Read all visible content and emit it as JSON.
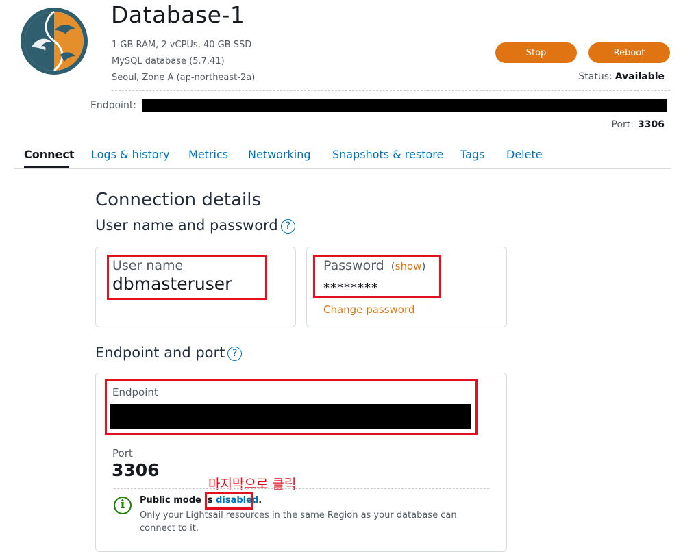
{
  "header": {
    "title": "Database-1",
    "specs": [
      "1 GB RAM, 2 vCPUs, 40 GB SSD",
      "MySQL database (5.7.41)",
      "Seoul, Zone A (ap-northeast-2a)"
    ],
    "stop_label": "Stop",
    "reboot_label": "Reboot",
    "status_label": "Status:",
    "status_value": "Available",
    "endpoint_label": "Endpoint:",
    "port_label": "Port:",
    "port_value": "3306",
    "logo_icon": "mysql-dolphin-icon"
  },
  "tabs": [
    {
      "label": "Connect",
      "active": true
    },
    {
      "label": "Logs & history"
    },
    {
      "label": "Metrics"
    },
    {
      "label": "Networking"
    },
    {
      "label": "Snapshots & restore"
    },
    {
      "label": "Tags"
    },
    {
      "label": "Delete"
    }
  ],
  "connection": {
    "heading": "Connection details",
    "userpass_heading": "User name and password",
    "help_glyph": "?",
    "user_label": "User name",
    "user_value": "dbmasteruser",
    "password_label": "Password",
    "show_open": "(",
    "show_label": "show",
    "show_close": ")",
    "password_value": "********",
    "change_password_label": "Change password"
  },
  "endpoint_section": {
    "heading": "Endpoint and port",
    "endpoint_label": "Endpoint",
    "port_label": "Port",
    "port_value": "3306",
    "annotation": "마지막으로 클릭",
    "public_mode_prefix": "Public mode is ",
    "public_mode_link": "disabled",
    "public_mode_suffix": ".",
    "public_mode_desc": "Only your Lightsail resources in the same Region as your database can connect to it.",
    "info_glyph": "i"
  },
  "colors": {
    "accent_orange": "#e07412",
    "link_blue": "#0073bb",
    "highlight_red": "#e0121f",
    "info_green": "#1d8102"
  }
}
